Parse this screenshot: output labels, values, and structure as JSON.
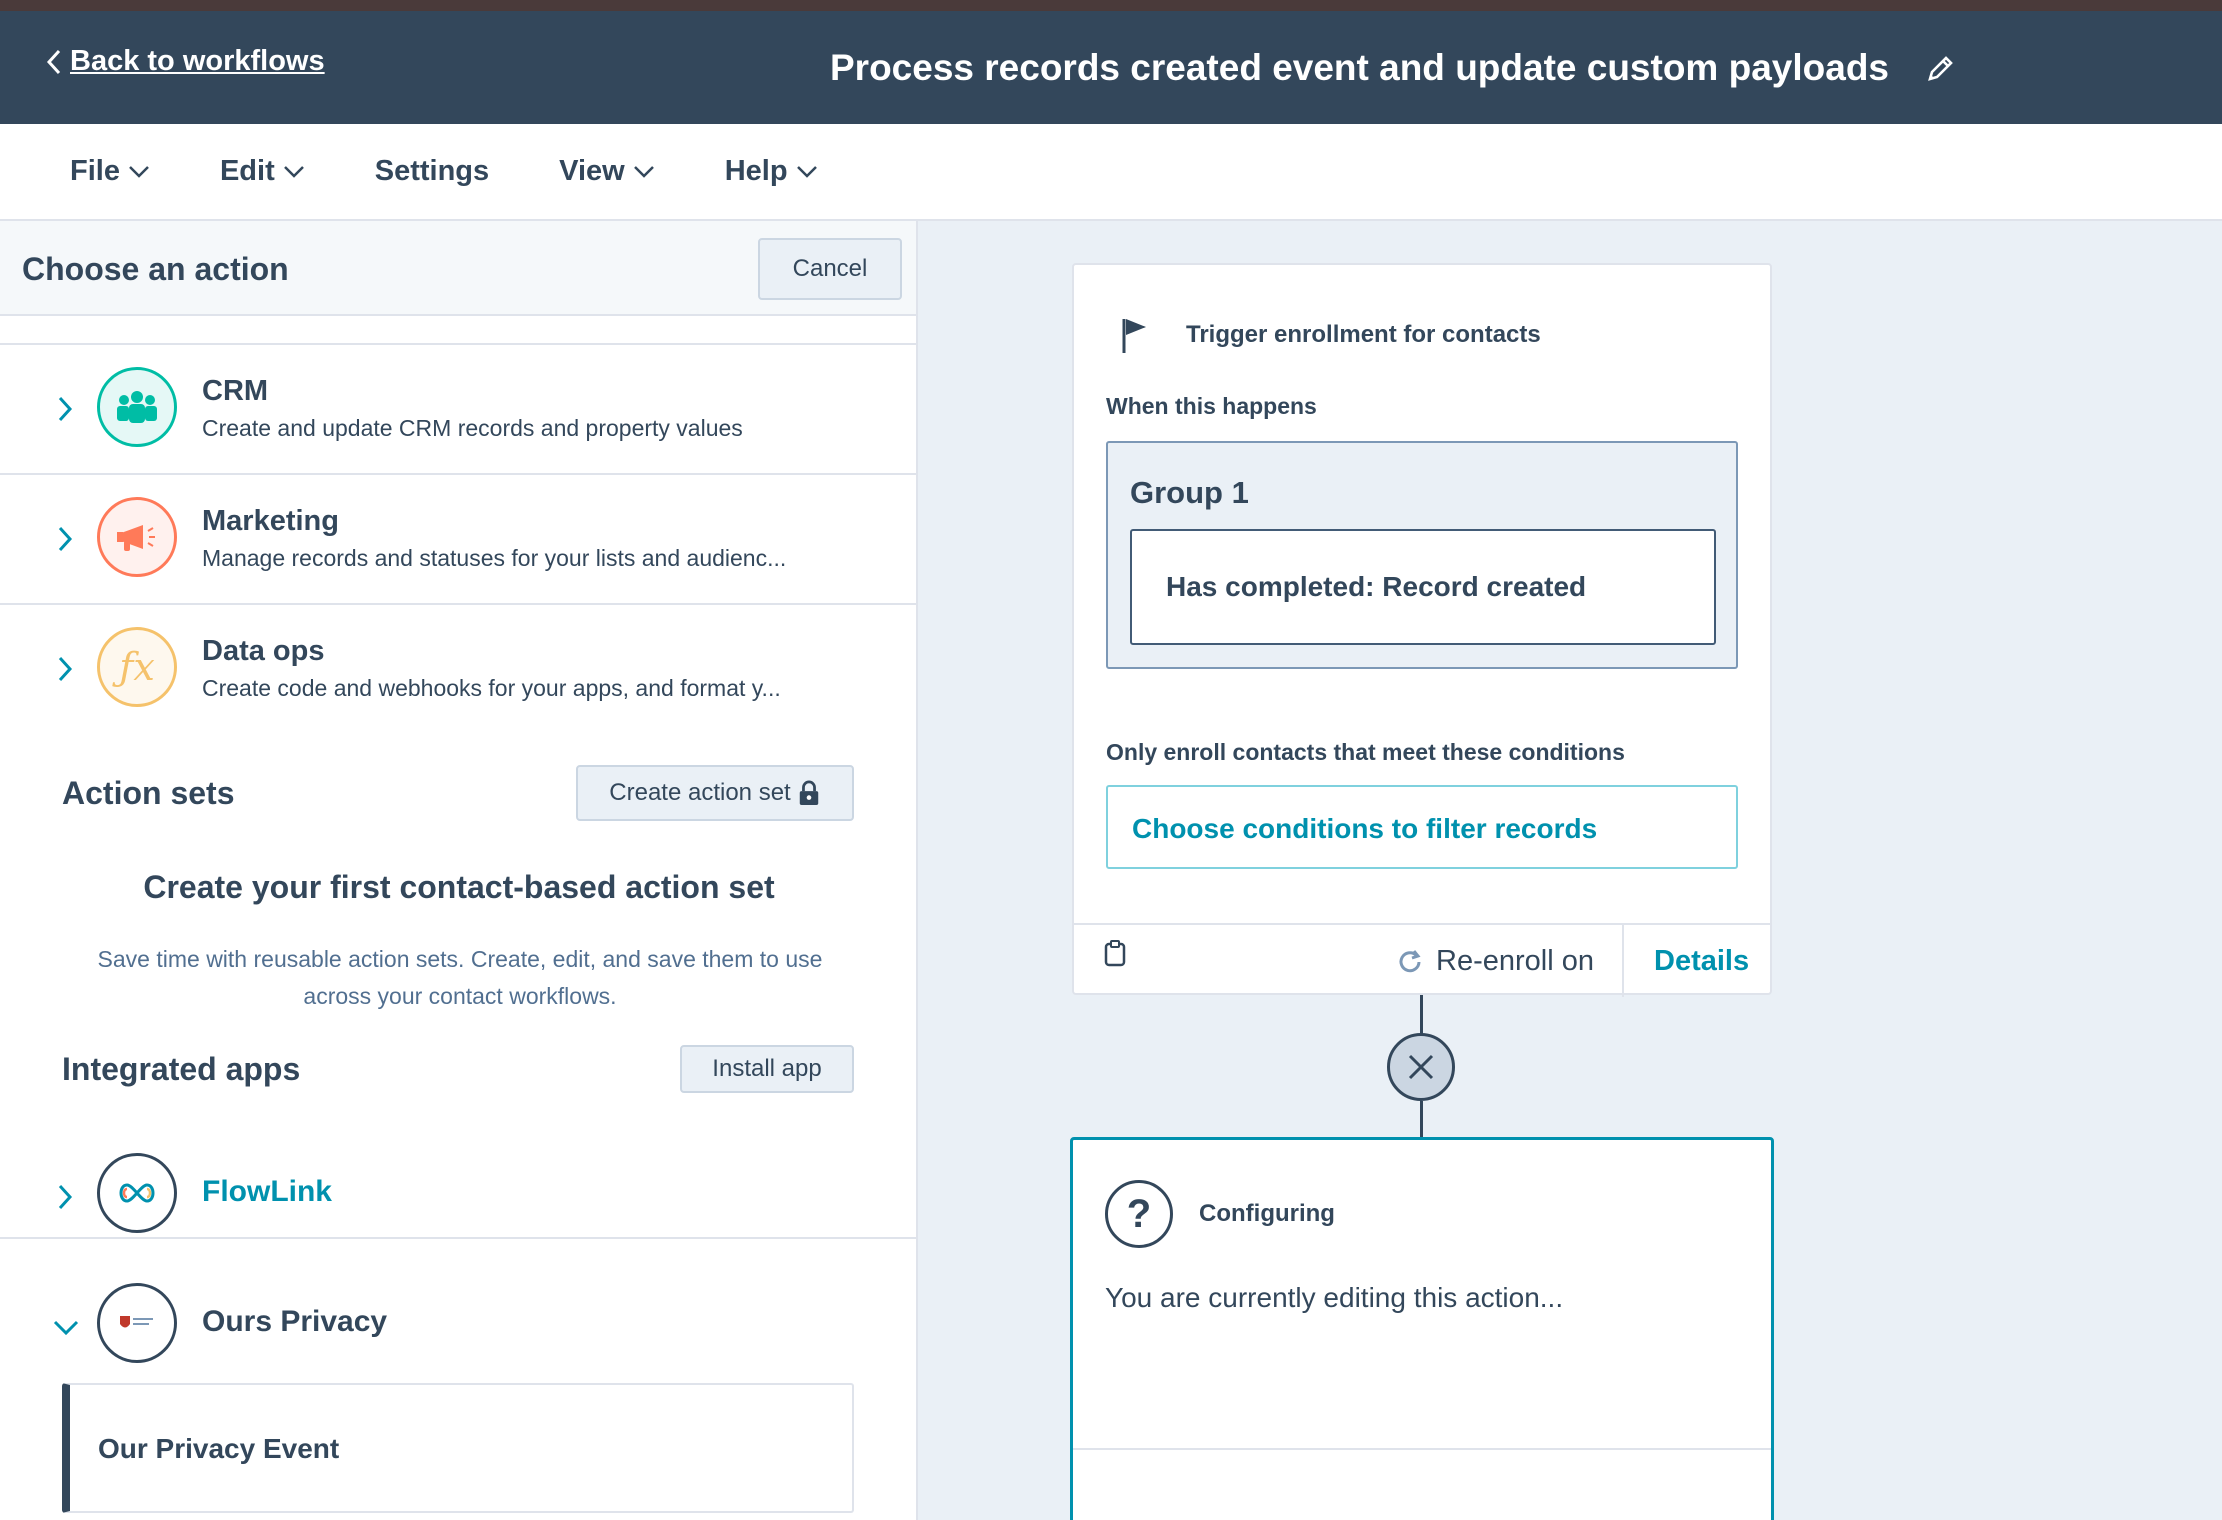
{
  "header": {
    "back_label": "Back to workflows",
    "title": "Process records created event and update custom payloads"
  },
  "menu": {
    "items": [
      {
        "label": "File",
        "has_dropdown": true
      },
      {
        "label": "Edit",
        "has_dropdown": true
      },
      {
        "label": "Settings",
        "has_dropdown": false
      },
      {
        "label": "View",
        "has_dropdown": true
      },
      {
        "label": "Help",
        "has_dropdown": true
      }
    ]
  },
  "panel": {
    "title": "Choose an action",
    "cancel_label": "Cancel",
    "categories": [
      {
        "name": "CRM",
        "description": "Create and update CRM records and property values",
        "icon": "people-icon",
        "color": "#00bda5"
      },
      {
        "name": "Marketing",
        "description": "Manage records and statuses for your lists and audienc...",
        "icon": "megaphone-icon",
        "color": "#ff7a59"
      },
      {
        "name": "Data ops",
        "description": "Create code and webhooks for your apps, and format y...",
        "icon": "function-icon",
        "color": "#f5c26b"
      }
    ],
    "action_sets": {
      "title": "Action sets",
      "create_label": "Create action set",
      "empty_title": "Create your first contact-based action set",
      "empty_desc": "Save time with reusable action sets. Create, edit, and save them to use across your contact workflows."
    },
    "integrated_apps": {
      "title": "Integrated apps",
      "install_label": "Install app",
      "apps": [
        {
          "name": "FlowLink",
          "icon": "infinity-link-icon",
          "color": "#0091ae",
          "expanded": false
        },
        {
          "name": "Ours Privacy",
          "icon": "ours-privacy-logo",
          "color": "#33475b",
          "expanded": true
        }
      ],
      "event_label": "Our Privacy Event"
    }
  },
  "canvas": {
    "trigger": {
      "title": "Trigger enrollment for contacts",
      "when_label": "When this happens",
      "group_title": "Group 1",
      "condition": "Has completed: Record created",
      "only_enroll_label": "Only enroll contacts that meet these conditions",
      "filter_label": "Choose conditions to filter records",
      "reenroll_label": "Re-enroll on",
      "details_label": "Details"
    },
    "config": {
      "title": "Configuring",
      "description": "You are currently editing this action..."
    }
  },
  "colors": {
    "header_bg": "#33475b",
    "accent": "#0091ae",
    "canvas_bg": "#eaf0f6"
  }
}
